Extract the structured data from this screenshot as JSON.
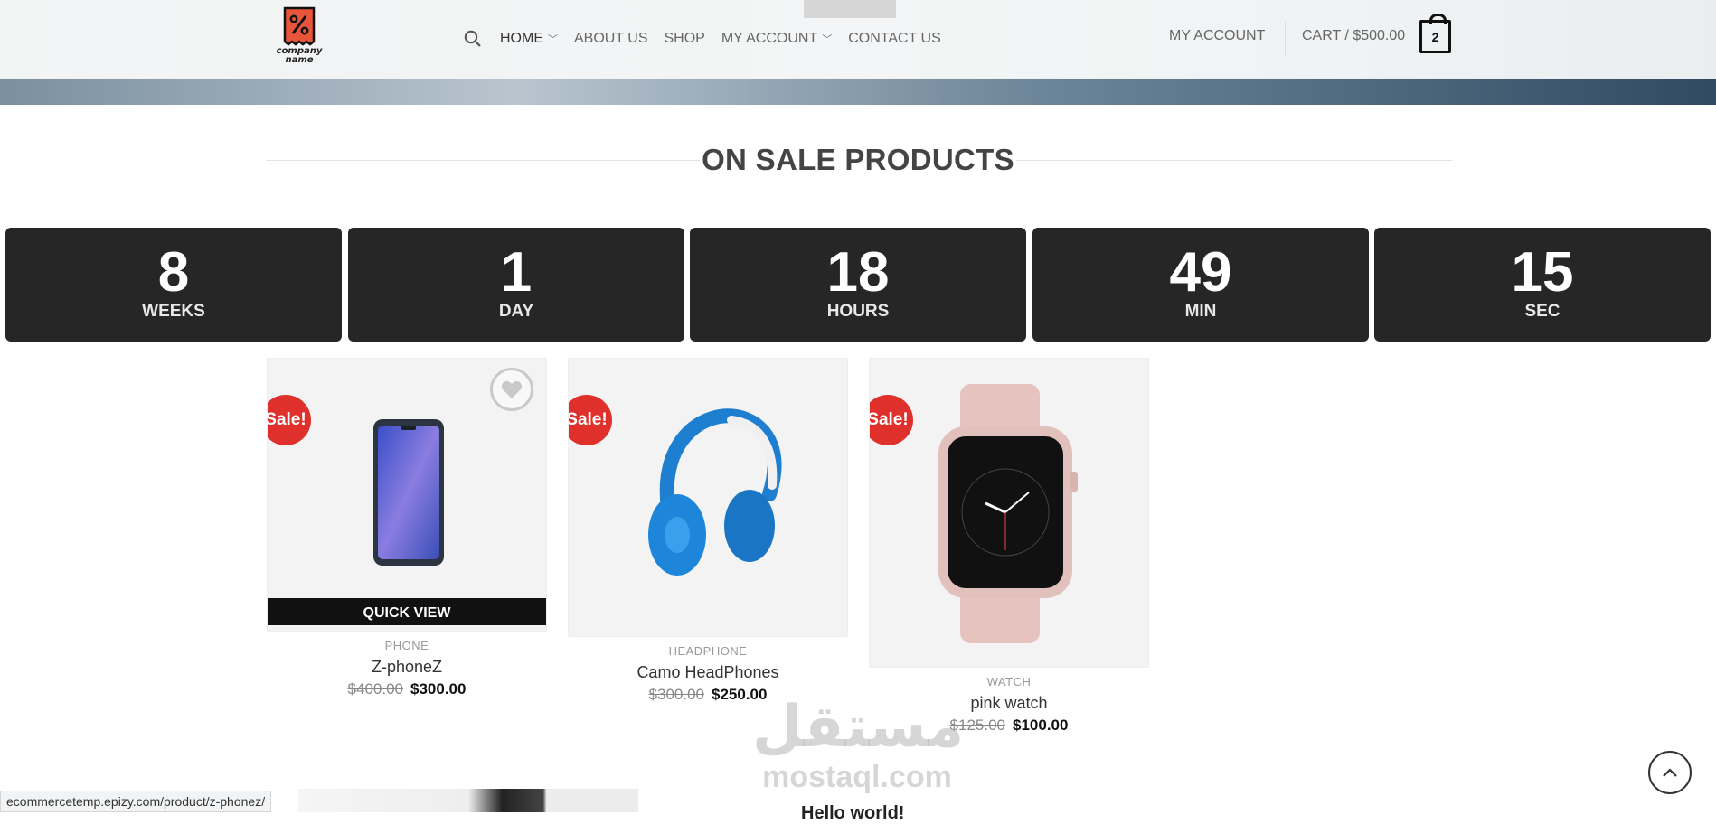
{
  "header": {
    "logo_line1": "company",
    "logo_line2": "name",
    "nav": [
      {
        "label": "HOME",
        "has_dropdown": true
      },
      {
        "label": "ABOUT US",
        "has_dropdown": false
      },
      {
        "label": "SHOP",
        "has_dropdown": false
      },
      {
        "label": "MY ACCOUNT",
        "has_dropdown": true
      },
      {
        "label": "CONTACT US",
        "has_dropdown": false
      }
    ],
    "account_link": "MY ACCOUNT",
    "cart_label": "CART / $500.00",
    "cart_count": "2",
    "chevron": "﹀"
  },
  "section": {
    "title": "ON SALE PRODUCTS"
  },
  "countdown": [
    {
      "value": "8",
      "unit": "WEEKS"
    },
    {
      "value": "1",
      "unit": "DAY"
    },
    {
      "value": "18",
      "unit": "HOURS"
    },
    {
      "value": "49",
      "unit": "MIN"
    },
    {
      "value": "15",
      "unit": "SEC"
    }
  ],
  "products": [
    {
      "badge": "Sale!",
      "category": "PHONE",
      "name": "Z-phoneZ",
      "old_price": "$400.00",
      "new_price": "$300.00",
      "quick_view": "QUICK VIEW"
    },
    {
      "badge": "Sale!",
      "category": "HEADPHONE",
      "name": "Camo HeadPhones",
      "old_price": "$300.00",
      "new_price": "$250.00"
    },
    {
      "badge": "Sale!",
      "category": "WATCH",
      "name": "pink watch",
      "old_price": "$125.00",
      "new_price": "$100.00"
    }
  ],
  "watermark": {
    "arabic": "مستقل",
    "latin": "mostaql.com"
  },
  "post": {
    "title": "Hello world!"
  },
  "status_bar": {
    "url": "ecommercetemp.epizy.com/product/z-phonez/"
  },
  "colors": {
    "sale_red": "#e0302b",
    "countdown_bg": "#262626",
    "logo_orange": "#e8553a"
  },
  "icons": [
    "search-icon",
    "chevron-down-icon",
    "cart-icon",
    "heart-icon",
    "arrow-up-icon"
  ]
}
